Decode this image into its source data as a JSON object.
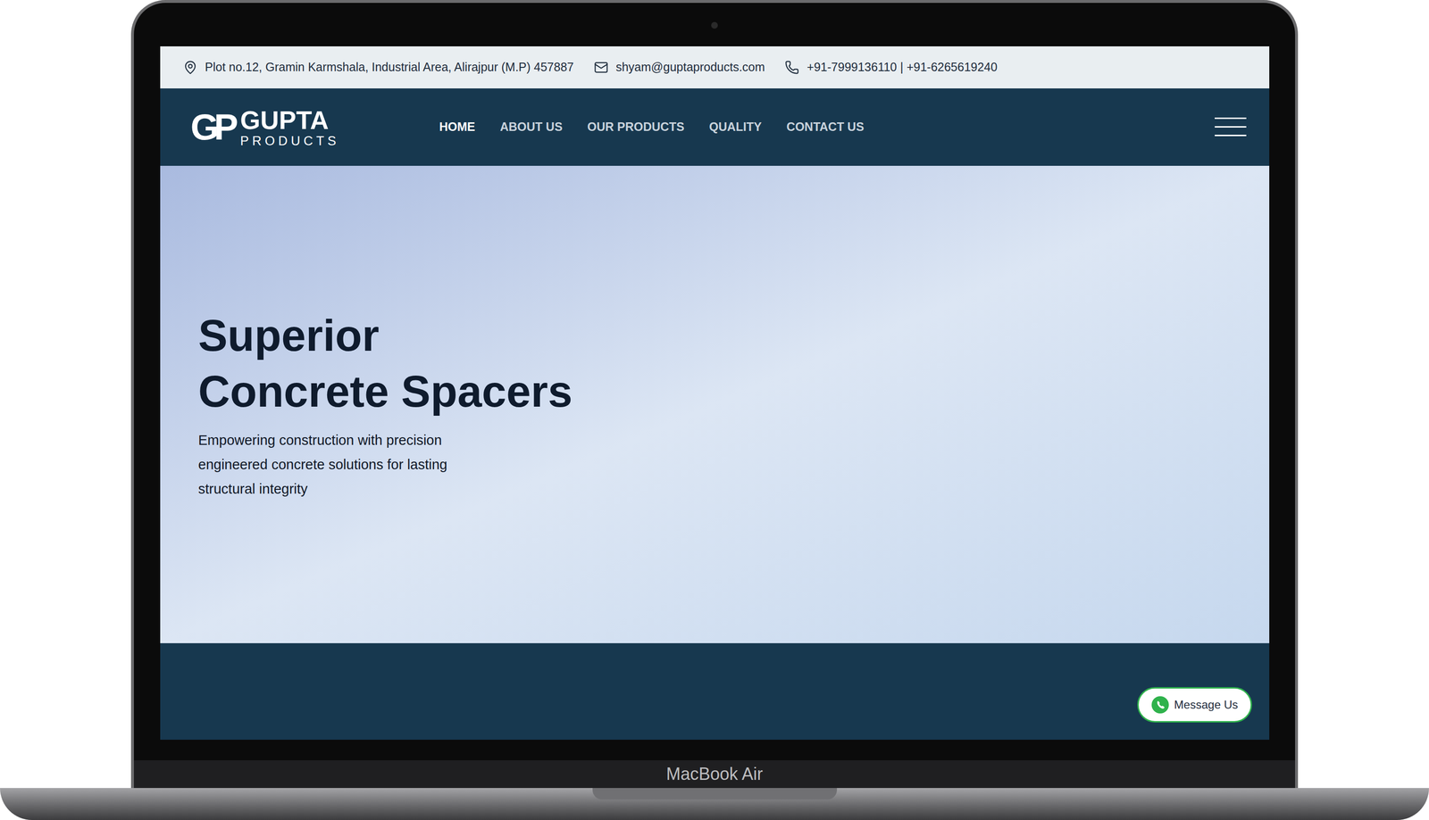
{
  "device": {
    "label": "MacBook Air"
  },
  "topbar": {
    "address": "Plot no.12, Gramin Karmshala, Industrial Area, Alirajpur (M.P) 457887",
    "email": "shyam@guptaproducts.com",
    "phone": "+91-7999136110 | +91-6265619240"
  },
  "logo": {
    "mark": "GP",
    "title": "GUPTA",
    "subtitle": "PRODUCTS"
  },
  "nav": [
    {
      "label": "HOME",
      "selected": true
    },
    {
      "label": "ABOUT US",
      "selected": false
    },
    {
      "label": "OUR PRODUCTS",
      "selected": false
    },
    {
      "label": "QUALITY",
      "selected": false
    },
    {
      "label": "CONTACT US",
      "selected": false
    }
  ],
  "hero": {
    "title_lines": [
      "Superior",
      "Concrete Spacers"
    ],
    "text_lines": [
      "Empowering construction with precision",
      "engineered concrete solutions for lasting",
      "structural integrity"
    ]
  },
  "whatsapp": {
    "label": "Message Us"
  }
}
